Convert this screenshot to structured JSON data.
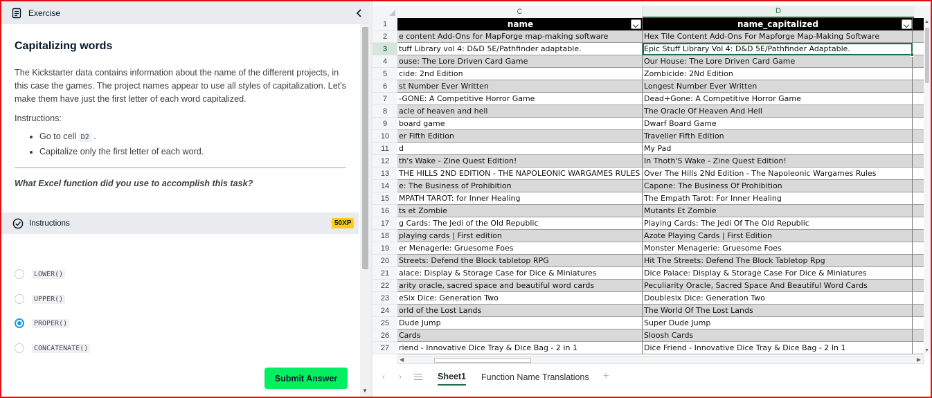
{
  "exercise": {
    "header_label": "Exercise",
    "title": "Capitalizing words",
    "description": "The Kickstarter data contains information about the name of the different projects, in this case the games. The project names appear to use all styles of capitalization. Let's make them have just the first letter of each word capitalized.",
    "instructions_label": "Instructions:",
    "steps": [
      {
        "pre": "Go to cell ",
        "code": "D2",
        "post": " ."
      },
      {
        "pre": "Capitalize only the first letter of each word.",
        "code": "",
        "post": ""
      }
    ],
    "question": "What Excel function did you use to accomplish this task?",
    "instructions_bar_label": "Instructions",
    "xp_badge": "50XP",
    "options": [
      {
        "label": "LOWER()",
        "selected": false
      },
      {
        "label": "UPPER()",
        "selected": false
      },
      {
        "label": "PROPER()",
        "selected": true
      },
      {
        "label": "CONCATENATE()",
        "selected": false
      }
    ],
    "submit_label": "Submit Answer"
  },
  "sheet": {
    "col_c_letter": "C",
    "col_d_letter": "D",
    "selected_cell": "D3",
    "header": {
      "row": "1",
      "c": "name",
      "d": "name_capitalized"
    },
    "rows": [
      {
        "n": "2",
        "c": "e content Add-Ons for MapForge map-making software",
        "d": "Hex Tile Content Add-Ons For Mapforge Map-Making Software"
      },
      {
        "n": "3",
        "c": "tuff Library vol 4: D&D 5E/Pathfinder adaptable.",
        "d": "Epic Stuff Library Vol 4: D&D 5E/Pathfinder Adaptable."
      },
      {
        "n": "4",
        "c": "ouse: The Lore Driven Card Game",
        "d": "Our House: The Lore Driven Card Game"
      },
      {
        "n": "5",
        "c": "cide: 2nd Edition",
        "d": "Zombicide: 2Nd Edition"
      },
      {
        "n": "6",
        "c": "st Number Ever Written",
        "d": "Longest Number Ever Written"
      },
      {
        "n": "7",
        "c": "-GONE: A Competitive Horror Game",
        "d": "Dead+Gone: A Competitive Horror Game"
      },
      {
        "n": "8",
        "c": "acle of heaven and hell",
        "d": "The Oracle Of Heaven And Hell"
      },
      {
        "n": "9",
        "c": "board game",
        "d": "Dwarf Board Game"
      },
      {
        "n": "10",
        "c": "er Fifth Edition",
        "d": "Traveller Fifth Edition"
      },
      {
        "n": "11",
        "c": "d",
        "d": "My Pad"
      },
      {
        "n": "12",
        "c": "th's Wake - Zine Quest Edition!",
        "d": "In Thoth'S Wake - Zine Quest Edition!"
      },
      {
        "n": "13",
        "c": "THE HILLS 2ND EDITION - THE NAPOLEONIC WARGAMES RULES",
        "d": "Over The Hills 2Nd Edition - The Napoleonic Wargames Rules"
      },
      {
        "n": "14",
        "c": "e: The Business of Prohibition",
        "d": "Capone: The Business Of Prohibition"
      },
      {
        "n": "15",
        "c": "MPATH TAROT: for Inner Healing",
        "d": "The Empath Tarot: For Inner Healing"
      },
      {
        "n": "16",
        "c": "ts et Zombie",
        "d": "Mutants Et Zombie"
      },
      {
        "n": "17",
        "c": "g Cards: The Jedi of the Old Republic",
        "d": "Playing Cards: The Jedi Of The Old Republic"
      },
      {
        "n": "18",
        "c": "playing cards | First edition",
        "d": "Azote Playing Cards | First Edition"
      },
      {
        "n": "19",
        "c": "er Menagerie: Gruesome Foes",
        "d": "Monster Menagerie: Gruesome Foes"
      },
      {
        "n": "20",
        "c": " Streets: Defend the Block tabletop RPG",
        "d": "Hit The Streets: Defend The Block Tabletop Rpg"
      },
      {
        "n": "21",
        "c": "alace: Display & Storage Case for Dice & Miniatures",
        "d": "Dice Palace: Display & Storage Case For Dice & Miniatures"
      },
      {
        "n": "22",
        "c": "arity oracle, sacred space and beautiful word cards",
        "d": "Peculiarity Oracle, Sacred Space And Beautiful Word Cards"
      },
      {
        "n": "23",
        "c": "eSix Dice: Generation Two",
        "d": "Doublesix Dice: Generation Two"
      },
      {
        "n": "24",
        "c": "orld of the Lost Lands",
        "d": "The World Of The Lost Lands"
      },
      {
        "n": "25",
        "c": " Dude Jump",
        "d": "Super Dude Jump"
      },
      {
        "n": "26",
        "c": " Cards",
        "d": "Sloosh Cards"
      },
      {
        "n": "27",
        "c": "riend - Innovative Dice Tray & Dice Bag - 2 in 1",
        "d": "Dice Friend - Innovative Dice Tray & Dice Bag - 2 In 1"
      }
    ],
    "tabs": [
      {
        "label": "Sheet1",
        "active": true
      },
      {
        "label": "Function Name Translations",
        "active": false
      }
    ],
    "add_tab": "+"
  },
  "colors": {
    "accent_green": "#03ef62",
    "xp_yellow": "#fcce0d",
    "radio_blue": "#1b9af0",
    "sheet_green": "#1e7145",
    "highlight_border": "#e01010"
  }
}
